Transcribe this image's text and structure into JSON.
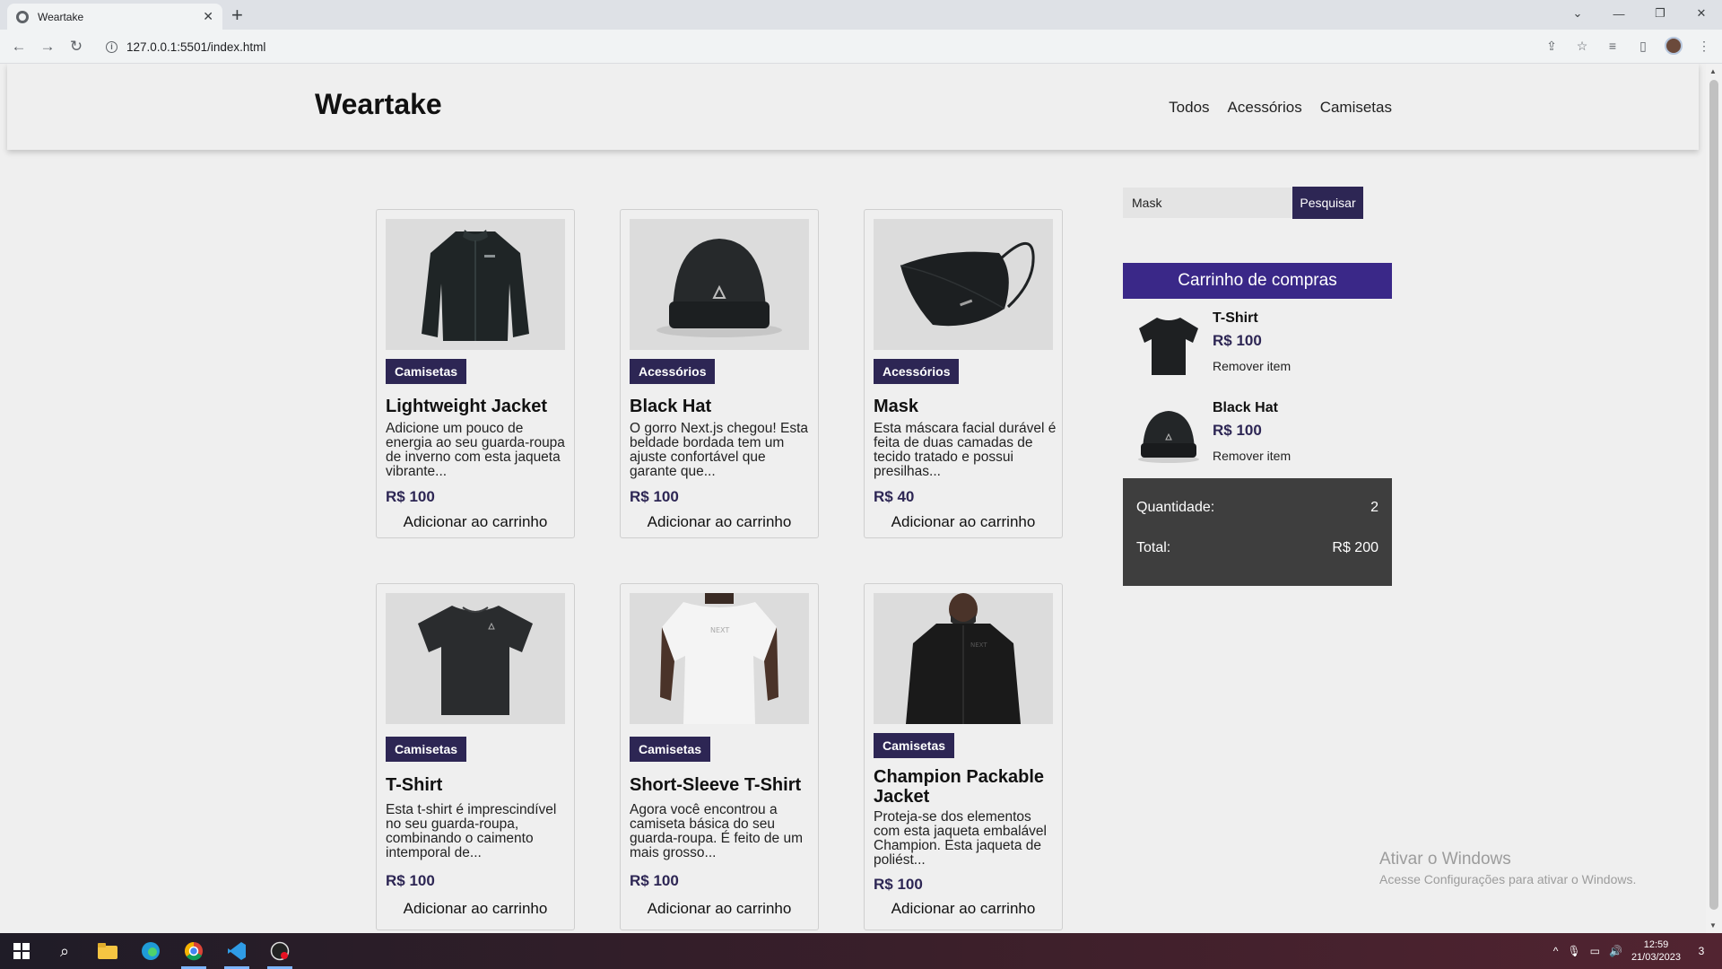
{
  "browser": {
    "tab_title": "Weartake",
    "url": "127.0.0.1:5501/index.html"
  },
  "site": {
    "logo": "Weartake",
    "nav": [
      "Todos",
      "Acessórios",
      "Camisetas"
    ]
  },
  "products": [
    {
      "category": "Camisetas",
      "name": "Lightweight Jacket",
      "description": "Adicione um pouco de energia ao seu guarda-roupa de inverno com esta jaqueta vibrante...",
      "price": "R$ 100",
      "add_label": "Adicionar ao carrinho",
      "image_icon": "jacket-icon"
    },
    {
      "category": "Acessórios",
      "name": "Black Hat",
      "description": "O gorro Next.js chegou! Esta beldade bordada tem um ajuste confortável que garante que...",
      "price": "R$ 100",
      "add_label": "Adicionar ao carrinho",
      "image_icon": "beanie-icon"
    },
    {
      "category": "Acessórios",
      "name": "Mask",
      "description": "Esta máscara facial durável é feita de duas camadas de tecido tratado e possui presilhas...",
      "price": "R$ 40",
      "add_label": "Adicionar ao carrinho",
      "image_icon": "mask-icon"
    },
    {
      "category": "Camisetas",
      "name": "T-Shirt",
      "description": "Esta t-shirt é imprescindível no seu guarda-roupa, combinando o caimento intemporal de...",
      "price": "R$ 100",
      "add_label": "Adicionar ao carrinho",
      "image_icon": "tshirt-icon"
    },
    {
      "category": "Camisetas",
      "name": "Short-Sleeve T-Shirt",
      "description": "Agora você encontrou a camiseta básica do seu guarda-roupa. É feito de um mais grosso...",
      "price": "R$ 100",
      "add_label": "Adicionar ao carrinho",
      "image_icon": "white-tshirt-icon"
    },
    {
      "category": "Camisetas",
      "name": "Champion Packable Jacket",
      "description": "Proteja-se dos elementos com esta jaqueta embalável Champion. Esta jaqueta de poliést...",
      "price": "R$ 100",
      "add_label": "Adicionar ao carrinho",
      "image_icon": "packable-jacket-icon"
    }
  ],
  "search": {
    "value": "Mask",
    "button": "Pesquisar"
  },
  "cart": {
    "title": "Carrinho de compras",
    "items": [
      {
        "name": "T-Shirt",
        "price": "R$ 100",
        "remove": "Remover item"
      },
      {
        "name": "Black Hat",
        "price": "R$ 100",
        "remove": "Remover item"
      }
    ],
    "quantity_label": "Quantidade:",
    "quantity": "2",
    "total_label": "Total:",
    "total": "R$ 200"
  },
  "watermark": {
    "line1": "Ativar o Windows",
    "line2": "Acesse Configurações para ativar o Windows."
  },
  "taskbar": {
    "time": "12:59",
    "date": "21/03/2023",
    "notifications": "3"
  },
  "colors": {
    "accent": "#2d2654",
    "cart_header": "#3a2888",
    "summary_bg": "#3e3e3e"
  }
}
